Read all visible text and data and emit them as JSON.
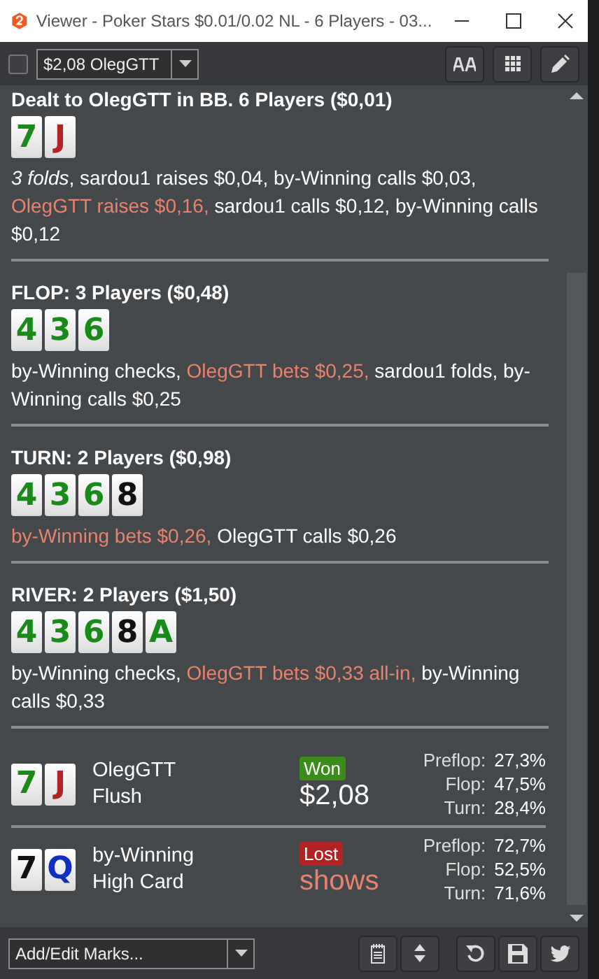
{
  "window": {
    "title": "Viewer - Poker Stars $0.01/0.02 NL - 6 Players - 03..."
  },
  "toolbar": {
    "checked": false,
    "player_select": "$2,08 OlegGTT"
  },
  "streets": [
    {
      "heading": "Dealt to OlegGTT in BB. 6 Players ($0,01)",
      "cards": [
        {
          "rank": "7",
          "color": "#1a8a1a"
        },
        {
          "rank": "J",
          "color": "#b02424"
        }
      ],
      "actions": [
        {
          "text": "3 folds",
          "highlight": false,
          "italic": true
        },
        {
          "text": ", sardou1 raises $0,04, by-Winning calls $0,03, ",
          "highlight": false
        },
        {
          "text": "OlegGTT raises $0,16,",
          "highlight": true
        },
        {
          "text": " sardou1 calls $0,12, by-Winning calls $0,12",
          "highlight": false
        }
      ]
    },
    {
      "heading": "FLOP: 3 Players ($0,48)",
      "cards": [
        {
          "rank": "4",
          "color": "#1a8a1a"
        },
        {
          "rank": "3",
          "color": "#1a8a1a"
        },
        {
          "rank": "6",
          "color": "#1a8a1a"
        }
      ],
      "actions": [
        {
          "text": "by-Winning checks, ",
          "highlight": false
        },
        {
          "text": "OlegGTT bets $0,25,",
          "highlight": true
        },
        {
          "text": " sardou1 folds, by-Winning calls $0,25",
          "highlight": false
        }
      ]
    },
    {
      "heading": "TURN: 2 Players ($0,98)",
      "cards": [
        {
          "rank": "4",
          "color": "#1a8a1a"
        },
        {
          "rank": "3",
          "color": "#1a8a1a"
        },
        {
          "rank": "6",
          "color": "#1a8a1a"
        },
        {
          "rank": "8",
          "color": "#111111"
        }
      ],
      "actions": [
        {
          "text": "by-Winning bets $0,26,",
          "highlight": true
        },
        {
          "text": " OlegGTT calls $0,26",
          "highlight": false
        }
      ]
    },
    {
      "heading": "RIVER: 2 Players ($1,50)",
      "cards": [
        {
          "rank": "4",
          "color": "#1a8a1a"
        },
        {
          "rank": "3",
          "color": "#1a8a1a"
        },
        {
          "rank": "6",
          "color": "#1a8a1a"
        },
        {
          "rank": "8",
          "color": "#111111"
        },
        {
          "rank": "A",
          "color": "#1a8a1a"
        }
      ],
      "actions": [
        {
          "text": "by-Winning checks, ",
          "highlight": false
        },
        {
          "text": "OlegGTT bets $0,33 all-in,",
          "highlight": true
        },
        {
          "text": " by-Winning calls $0,33",
          "highlight": false
        }
      ]
    }
  ],
  "results": [
    {
      "player": "OlegGTT",
      "hand": "Flush",
      "cards": [
        {
          "rank": "7",
          "color": "#1a8a1a"
        },
        {
          "rank": "J",
          "color": "#b02424"
        }
      ],
      "won": true,
      "badge": "Won",
      "amount": "$2,08",
      "equity": [
        {
          "label": "Preflop:",
          "value": "27,3%"
        },
        {
          "label": "Flop:",
          "value": "47,5%"
        },
        {
          "label": "Turn:",
          "value": "28,4%"
        }
      ]
    },
    {
      "player": "by-Winning",
      "hand": "High Card",
      "cards": [
        {
          "rank": "7",
          "color": "#111111"
        },
        {
          "rank": "Q",
          "color": "#1030c0"
        }
      ],
      "won": false,
      "badge": "Lost",
      "amount": "shows",
      "equity": [
        {
          "label": "Preflop:",
          "value": "72,7%"
        },
        {
          "label": "Flop:",
          "value": "52,5%"
        },
        {
          "label": "Turn:",
          "value": "71,6%"
        }
      ]
    }
  ],
  "bottom": {
    "marks_select": "Add/Edit Marks..."
  }
}
